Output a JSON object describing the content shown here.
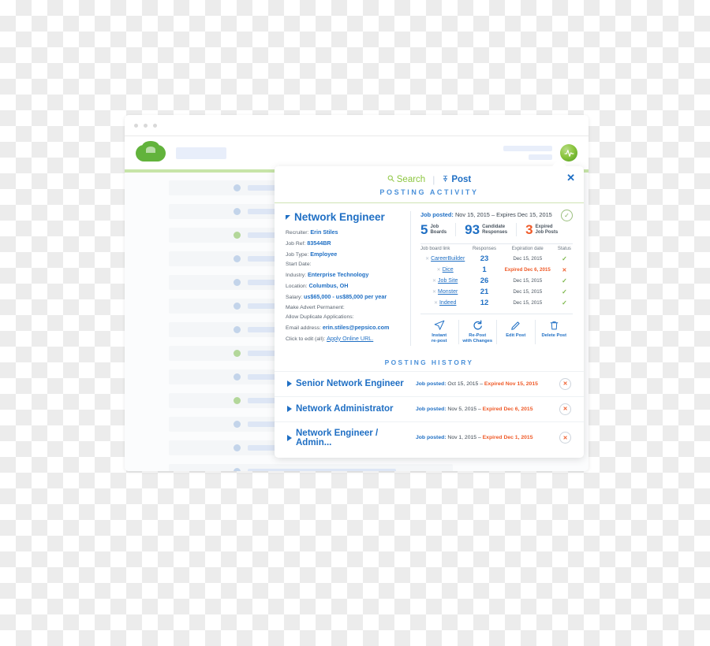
{
  "browser": {
    "window_dots": 3,
    "logo": "green-blob-logo",
    "avatar_icon": "activity-pulse-icon"
  },
  "background_list": {
    "rows": [
      {
        "dot": "blue",
        "bar": 200
      },
      {
        "dot": "blue",
        "bar": 190
      },
      {
        "dot": "green",
        "bar": 175
      },
      {
        "dot": "blue",
        "bar": 205
      },
      {
        "dot": "blue",
        "bar": 185
      },
      {
        "dot": "blue",
        "bar": 195
      },
      {
        "dot": "blue",
        "bar": 182
      },
      {
        "dot": "green",
        "bar": 170
      },
      {
        "dot": "blue",
        "bar": 198
      },
      {
        "dot": "green",
        "bar": 186
      },
      {
        "dot": "blue",
        "bar": 192
      },
      {
        "dot": "blue",
        "bar": 178
      },
      {
        "dot": "blue",
        "bar": 188
      }
    ]
  },
  "popup": {
    "tabs": [
      {
        "label": "Search",
        "icon": "search-icon",
        "active": false,
        "color": "#8cc63f"
      },
      {
        "label": "Post",
        "icon": "pin-icon",
        "active": true,
        "color": "#1f6fc4"
      }
    ],
    "section_title": "POSTING ACTIVITY",
    "close_label": "✕"
  },
  "job": {
    "title": "Network Engineer",
    "fields": [
      {
        "label": "Recruiter:",
        "value": "Erin Stiles",
        "type": "value"
      },
      {
        "label": "Job Ref:",
        "value": "83544BR",
        "type": "value"
      },
      {
        "label": "Job Type:",
        "value": "Employee",
        "type": "value"
      },
      {
        "label": "Start Date:",
        "value": "",
        "type": "value"
      },
      {
        "label": "Industry:",
        "value": "Enterprise Technology",
        "type": "value"
      },
      {
        "label": "Location:",
        "value": "Columbus, OH",
        "type": "value"
      },
      {
        "label": "Salary:",
        "value": "us$65,000 - us$85,000 per year",
        "type": "value"
      },
      {
        "label": "Make Advert Permanent:",
        "value": "",
        "type": "value"
      },
      {
        "label": "Allow Duplicate Applications:",
        "value": "",
        "type": "value"
      },
      {
        "label": "Email address:",
        "value": "erin.stiles@pepsico.com",
        "type": "value"
      },
      {
        "label": "Click to edit (all):",
        "value": "Apply Online URL.",
        "type": "link"
      }
    ]
  },
  "activity": {
    "posted_label": "Job posted:",
    "posted_range": "Nov 15, 2015 – Expires Dec 15, 2015",
    "status_icon": "check-circle-icon",
    "stats": [
      {
        "number": "5",
        "line1": "Job",
        "line2": "Boards",
        "color": "blue"
      },
      {
        "number": "93",
        "line1": "Candidate",
        "line2": "Responses",
        "color": "blue"
      },
      {
        "number": "3",
        "line1": "Expired",
        "line2": "Job Posts",
        "color": "red"
      }
    ],
    "table": {
      "headers": [
        "Job board link",
        "Responses",
        "Expiration date",
        "Status"
      ],
      "rows": [
        {
          "board": "CareerBuilder",
          "responses": "23",
          "expiration": "Dec 15, 2015",
          "expired": false,
          "status": "ok"
        },
        {
          "board": "Dice",
          "responses": "1",
          "expiration": "Expired Dec 6, 2015",
          "expired": true,
          "status": "fail"
        },
        {
          "board": "Job Site",
          "responses": "26",
          "expiration": "Dec 15, 2015",
          "expired": false,
          "status": "ok"
        },
        {
          "board": "Monster",
          "responses": "21",
          "expiration": "Dec 15, 2015",
          "expired": false,
          "status": "ok"
        },
        {
          "board": "Indeed",
          "responses": "12",
          "expiration": "Dec 15, 2015",
          "expired": false,
          "status": "ok"
        }
      ]
    },
    "actions": [
      {
        "icon": "paper-plane-icon",
        "line1": "Instant",
        "line2": "re-post"
      },
      {
        "icon": "refresh-icon",
        "line1": "Re-Post",
        "line2": "with Changes"
      },
      {
        "icon": "pencil-icon",
        "line1": "Edit Post",
        "line2": ""
      },
      {
        "icon": "trash-icon",
        "line1": "Delete Post",
        "line2": ""
      }
    ]
  },
  "history": {
    "title": "POSTING HISTORY",
    "rows": [
      {
        "name": "Senior Network Engineer",
        "posted_label": "Job posted:",
        "posted": "Oct 15, 2015 – ",
        "expired": "Expired Nov 15, 2015"
      },
      {
        "name": "Network Administrator",
        "posted_label": "Job posted:",
        "posted": "Nov 5, 2015 – ",
        "expired": "Expired Dec 6, 2015"
      },
      {
        "name": "Network Engineer / Admin...",
        "posted_label": "Job posted:",
        "posted": "Nov 1, 2015 – ",
        "expired": "Expired Dec 1, 2015"
      }
    ],
    "remove_label": "✕"
  },
  "colors": {
    "blue": "#1f6fc4",
    "green": "#8cc63f",
    "orange": "#ef5a28",
    "light_green_bar": "#c7e4a8"
  }
}
